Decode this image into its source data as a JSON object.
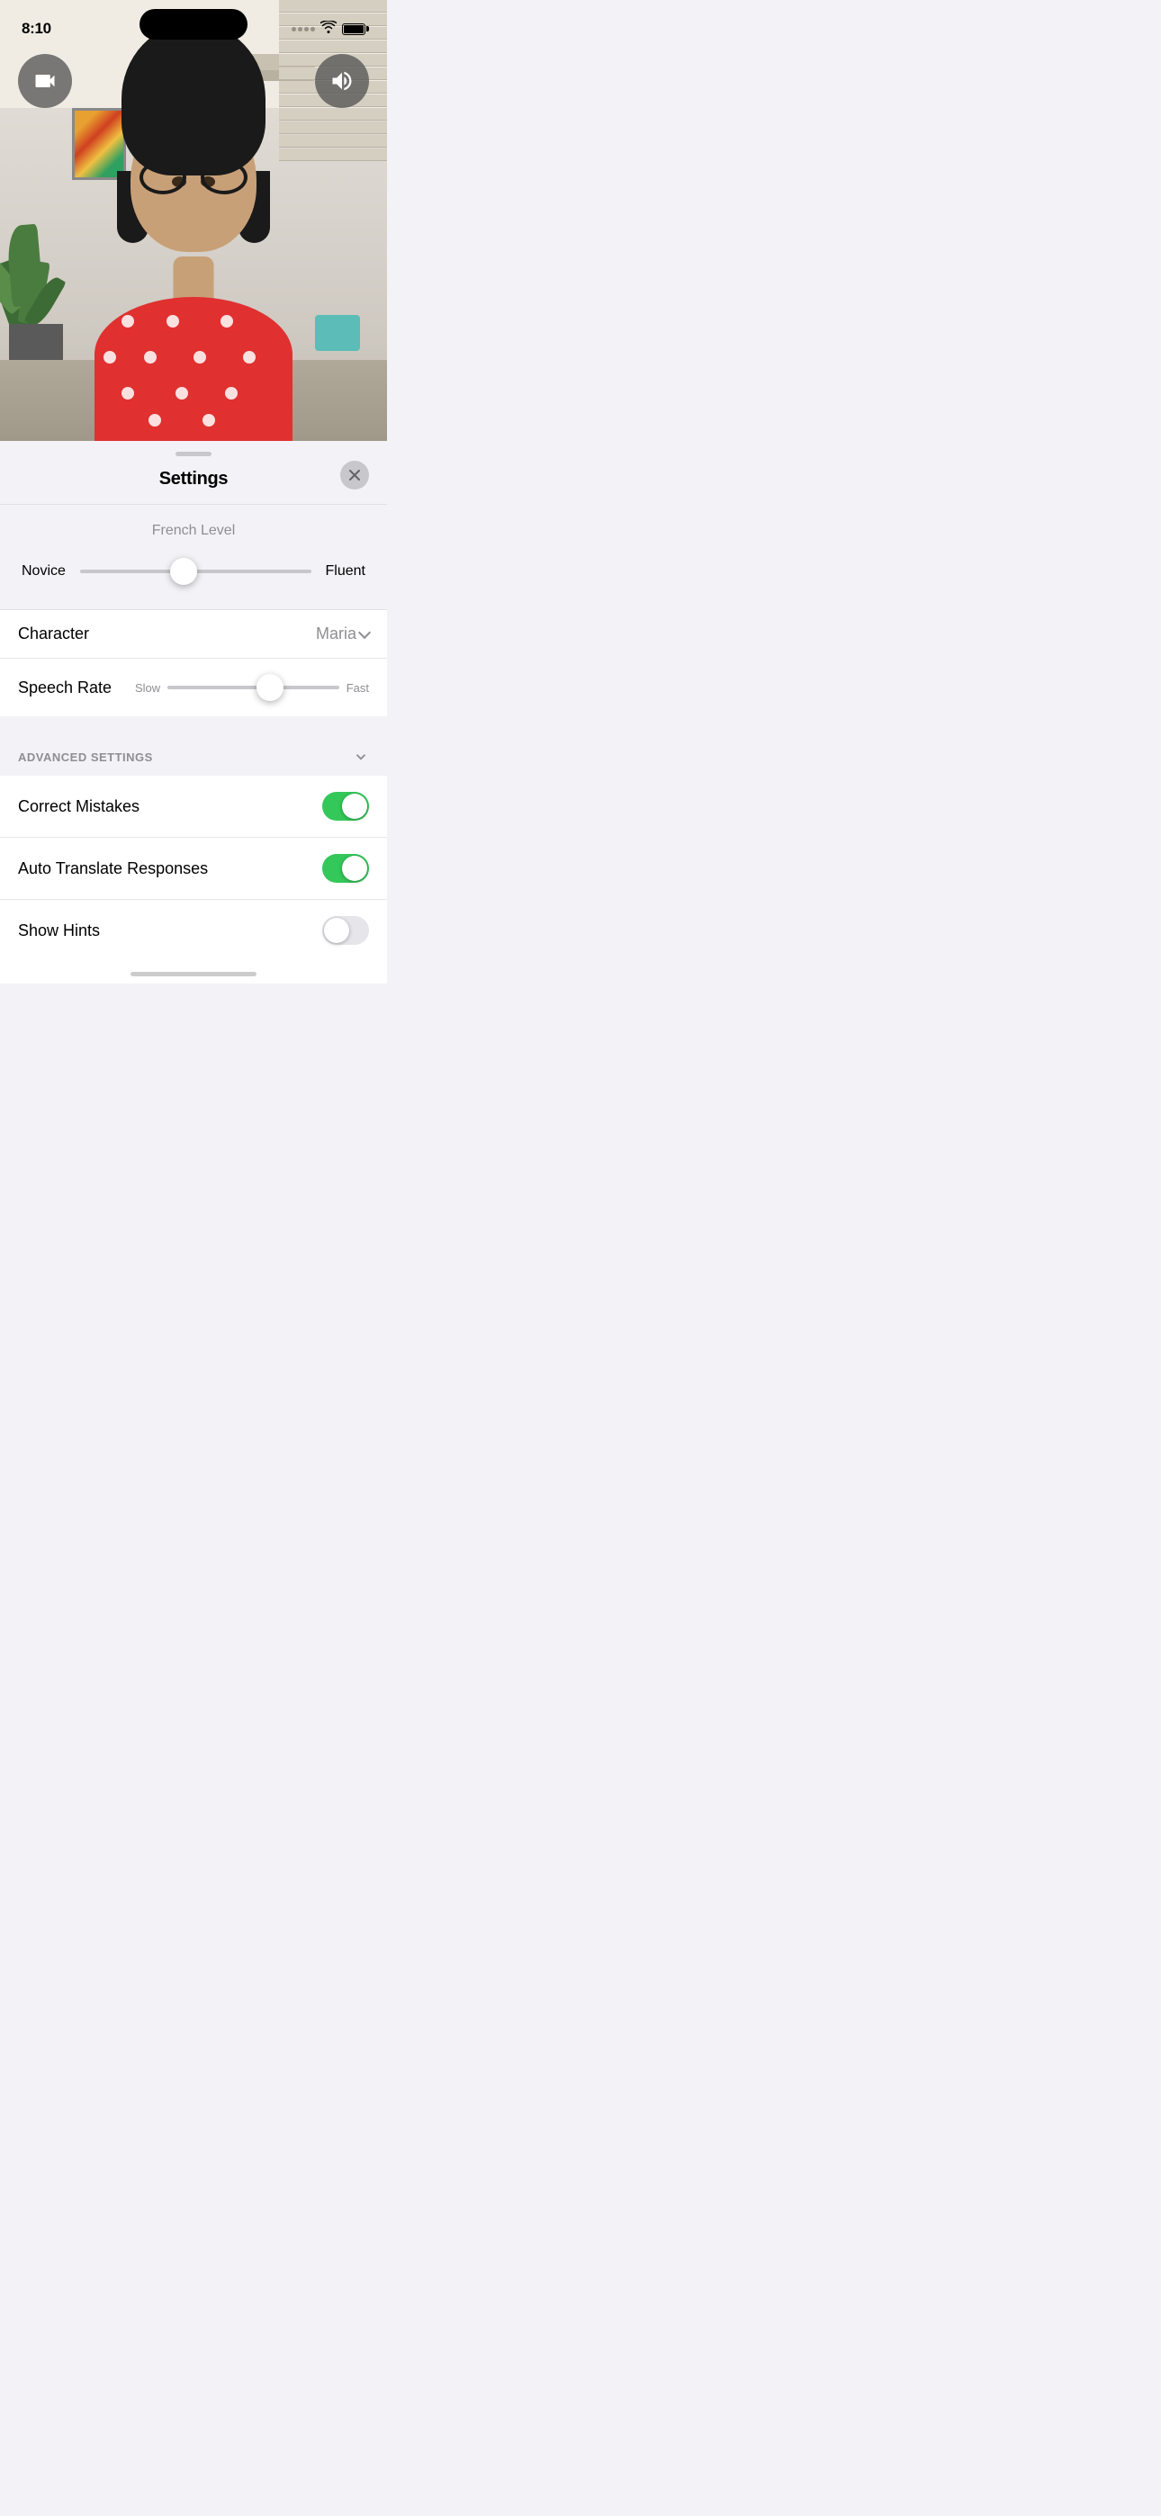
{
  "statusBar": {
    "time": "8:10",
    "batteryLevel": "full"
  },
  "avatarButtons": {
    "videoLabel": "video",
    "soundLabel": "sound"
  },
  "sheet": {
    "handle": "",
    "title": "Settings",
    "closeLabel": "close"
  },
  "frenchLevel": {
    "sectionLabel": "French Level",
    "minLabel": "Novice",
    "maxLabel": "Fluent",
    "sliderPercent": 45
  },
  "characterSetting": {
    "label": "Character",
    "value": "Maria",
    "chevron": "chevron-down"
  },
  "speechRate": {
    "label": "Speech Rate",
    "minLabel": "Slow",
    "maxLabel": "Fast",
    "sliderPercent": 60
  },
  "advancedSettings": {
    "title": "ADVANCED SETTINGS",
    "chevron": "chevron-down"
  },
  "toggles": [
    {
      "label": "Correct Mistakes",
      "state": "on"
    },
    {
      "label": "Auto Translate Responses",
      "state": "on"
    },
    {
      "label": "Show Hints",
      "state": "off"
    }
  ],
  "homeIndicator": ""
}
